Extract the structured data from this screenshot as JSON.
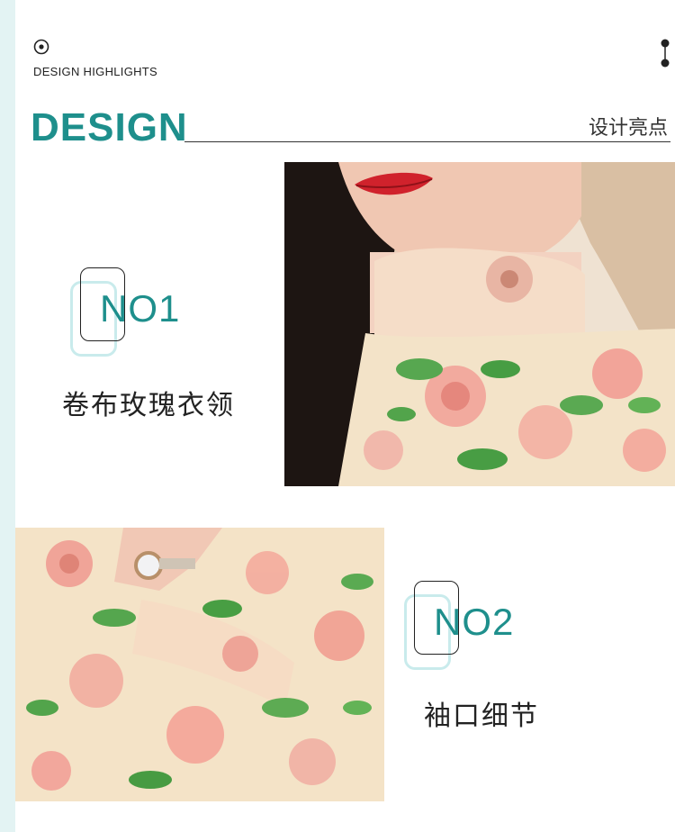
{
  "header": {
    "highlights_label": "DESIGN HIGHLIGHTS",
    "title": "DESIGN",
    "title_cn": "设计亮点"
  },
  "features": [
    {
      "number": "NO1",
      "caption": "卷布玫瑰衣领"
    },
    {
      "number": "NO2",
      "caption": "袖口细节"
    }
  ],
  "colors": {
    "accent": "#1e8f8c",
    "strip": "#e3f3f3",
    "frame_light": "#c9ebec"
  },
  "icons": {
    "top_left": "target-icon",
    "top_right": "vertical-dots-icon"
  }
}
